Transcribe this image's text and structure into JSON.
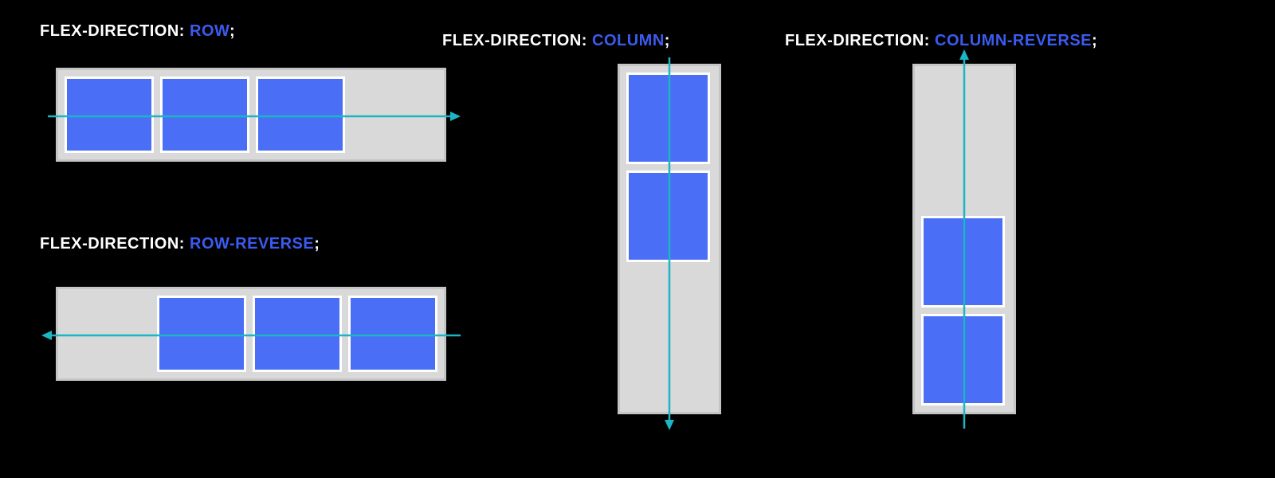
{
  "labels": {
    "row": {
      "prop": "FLEX-DIRECTION: ",
      "val": "ROW",
      "semi": ";"
    },
    "rowReverse": {
      "prop": "FLEX-DIRECTION: ",
      "val": "ROW-REVERSE",
      "semi": ";"
    },
    "column": {
      "prop": "FLEX-DIRECTION: ",
      "val": "COLUMN",
      "semi": ";"
    },
    "columnReverse": {
      "prop": "FLEX-DIRECTION: ",
      "val": "COLUMN-REVERSE",
      "semi": ";"
    }
  },
  "colors": {
    "background": "#000000",
    "container": "#d9d9d9",
    "containerBorder": "#c5c5c5",
    "box": "#4a6ef5",
    "boxBorder": "#ffffff",
    "arrow": "#1bb5c4",
    "labelText": "#ffffff",
    "valueText": "#3b5bf0"
  },
  "diagrams": {
    "row": {
      "boxCount": 3,
      "direction": "row",
      "arrow": "right"
    },
    "rowReverse": {
      "boxCount": 3,
      "direction": "row-reverse",
      "arrow": "left"
    },
    "column": {
      "boxCount": 2,
      "direction": "column",
      "arrow": "down"
    },
    "columnReverse": {
      "boxCount": 2,
      "direction": "column-reverse",
      "arrow": "up"
    }
  }
}
